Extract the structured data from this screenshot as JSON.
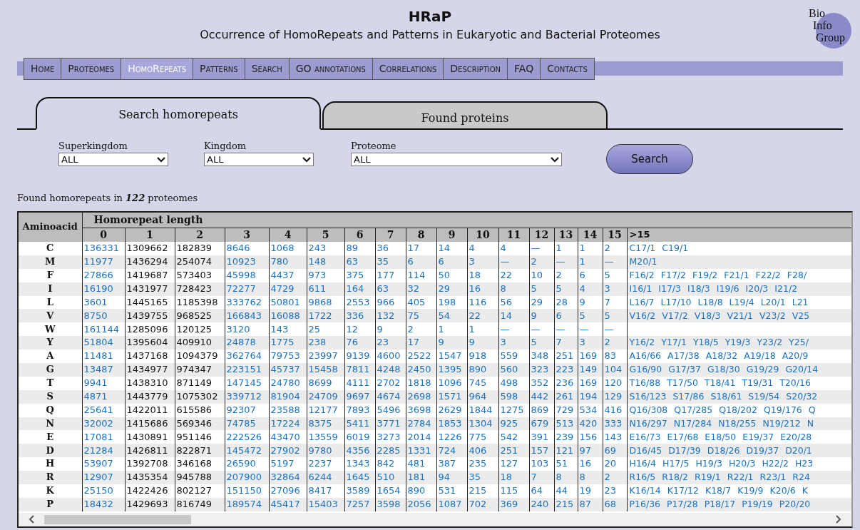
{
  "header": {
    "title": "HRaP",
    "subtitle": "Occurrence of HomoRepeats and Patterns in Eukaryotic and Bacterial Proteomes"
  },
  "logo": {
    "lines": [
      "Bio",
      "Info",
      "Group"
    ]
  },
  "nav": [
    {
      "label": "Home",
      "selected": false
    },
    {
      "label": "Proteomes",
      "selected": false
    },
    {
      "label": "HomoRepeats",
      "selected": true
    },
    {
      "label": "Patterns",
      "selected": false
    },
    {
      "label": "Search",
      "selected": false
    },
    {
      "label": "GO annotations",
      "selected": false
    },
    {
      "label": "Correlations",
      "selected": false
    },
    {
      "label": "Description",
      "selected": false
    },
    {
      "label": "FAQ",
      "selected": false
    },
    {
      "label": "Contacts",
      "selected": false
    }
  ],
  "tabs": [
    {
      "label": "Search homorepeats",
      "selected": true
    },
    {
      "label": "Found proteins",
      "selected": false
    }
  ],
  "filters": [
    {
      "label": "Superkingdom",
      "value": "ALL"
    },
    {
      "label": "Kingdom",
      "value": "ALL"
    },
    {
      "label": "Proteome",
      "value": "ALL"
    }
  ],
  "search_button": "Search",
  "summary": "Found homorepeats in **122** proteomes",
  "table": {
    "row_header": "Aminoacid",
    "group_header": "Homorepeat length",
    "columns": [
      {
        "label": "0",
        "linked": true
      },
      {
        "label": "1",
        "linked": false
      },
      {
        "label": "2",
        "linked": false
      },
      {
        "label": "3",
        "linked": true
      },
      {
        "label": "4",
        "linked": true
      },
      {
        "label": "5",
        "linked": true
      },
      {
        "label": "6",
        "linked": true
      },
      {
        "label": "7",
        "linked": true
      },
      {
        "label": "8",
        "linked": true
      },
      {
        "label": "9",
        "linked": true
      },
      {
        "label": "10",
        "linked": true
      },
      {
        "label": "11",
        "linked": true
      },
      {
        "label": "12",
        "linked": true
      },
      {
        "label": "13",
        "linked": true
      },
      {
        "label": "14",
        "linked": true
      },
      {
        "label": "15",
        "linked": true
      }
    ],
    "longer_header": ">15",
    "rows": [
      {
        "aminoacid": "C",
        "values": [
          "136331",
          "1309662",
          "182839",
          "8646",
          "1068",
          "243",
          "89",
          "36",
          "17",
          "14",
          "4",
          "4",
          "—",
          "1",
          "1",
          "2"
        ],
        "longer": [
          "C17/1",
          "C19/1"
        ]
      },
      {
        "aminoacid": "M",
        "values": [
          "11977",
          "1436294",
          "254074",
          "10923",
          "780",
          "148",
          "63",
          "35",
          "6",
          "6",
          "3",
          "—",
          "2",
          "—",
          "1",
          "—"
        ],
        "longer": [
          "M20/1"
        ]
      },
      {
        "aminoacid": "F",
        "values": [
          "27866",
          "1419687",
          "573403",
          "45998",
          "4437",
          "973",
          "375",
          "177",
          "114",
          "50",
          "18",
          "22",
          "10",
          "2",
          "6",
          "5"
        ],
        "longer": [
          "F16/2",
          "F17/2",
          "F19/2",
          "F21/1",
          "F22/2",
          "F28/"
        ]
      },
      {
        "aminoacid": "I",
        "values": [
          "16190",
          "1431977",
          "728423",
          "72277",
          "4729",
          "611",
          "164",
          "63",
          "32",
          "29",
          "16",
          "8",
          "5",
          "5",
          "4",
          "3"
        ],
        "longer": [
          "I16/1",
          "I17/3",
          "I18/3",
          "I19/6",
          "I20/3",
          "I21/2"
        ]
      },
      {
        "aminoacid": "L",
        "values": [
          "3601",
          "1445165",
          "1185398",
          "333762",
          "50801",
          "9868",
          "2553",
          "966",
          "405",
          "198",
          "116",
          "56",
          "29",
          "28",
          "9",
          "7"
        ],
        "longer": [
          "L16/7",
          "L17/10",
          "L18/8",
          "L19/4",
          "L20/1",
          "L21"
        ]
      },
      {
        "aminoacid": "V",
        "values": [
          "8750",
          "1439755",
          "968525",
          "166843",
          "16088",
          "1722",
          "336",
          "132",
          "75",
          "54",
          "22",
          "14",
          "9",
          "6",
          "5",
          "5"
        ],
        "longer": [
          "V16/2",
          "V17/2",
          "V18/3",
          "V21/1",
          "V23/2",
          "V25"
        ]
      },
      {
        "aminoacid": "W",
        "values": [
          "161144",
          "1285096",
          "120125",
          "3120",
          "143",
          "25",
          "12",
          "9",
          "2",
          "1",
          "1",
          "—",
          "—",
          "—",
          "—",
          "—"
        ]
      },
      {
        "aminoacid": "Y",
        "values": [
          "51804",
          "1395604",
          "409910",
          "24878",
          "1775",
          "238",
          "76",
          "23",
          "17",
          "9",
          "9",
          "3",
          "5",
          "7",
          "3",
          "2"
        ],
        "longer": [
          "Y16/2",
          "Y17/1",
          "Y18/5",
          "Y19/3",
          "Y23/2",
          "Y25/"
        ]
      },
      {
        "aminoacid": "A",
        "values": [
          "11481",
          "1437168",
          "1094379",
          "362764",
          "79753",
          "23997",
          "9139",
          "4600",
          "2522",
          "1547",
          "918",
          "559",
          "348",
          "251",
          "169",
          "83"
        ],
        "longer": [
          "A16/66",
          "A17/38",
          "A18/32",
          "A19/18",
          "A20/9"
        ]
      },
      {
        "aminoacid": "G",
        "values": [
          "13487",
          "1434977",
          "974347",
          "223151",
          "45737",
          "15458",
          "7811",
          "4248",
          "2450",
          "1395",
          "890",
          "560",
          "323",
          "223",
          "149",
          "104"
        ],
        "longer": [
          "G16/90",
          "G17/37",
          "G18/30",
          "G19/29",
          "G20/14"
        ]
      },
      {
        "aminoacid": "T",
        "values": [
          "9941",
          "1438310",
          "871149",
          "147145",
          "24780",
          "8699",
          "4111",
          "2702",
          "1818",
          "1096",
          "745",
          "498",
          "352",
          "236",
          "169",
          "120"
        ],
        "longer": [
          "T16/88",
          "T17/50",
          "T18/41",
          "T19/31",
          "T20/16"
        ]
      },
      {
        "aminoacid": "S",
        "values": [
          "4871",
          "1443779",
          "1075302",
          "339712",
          "81904",
          "24709",
          "9697",
          "4674",
          "2698",
          "1571",
          "964",
          "598",
          "442",
          "261",
          "194",
          "129"
        ],
        "longer": [
          "S16/123",
          "S17/86",
          "S18/61",
          "S19/54",
          "S20/32"
        ]
      },
      {
        "aminoacid": "Q",
        "values": [
          "25641",
          "1422011",
          "615586",
          "92307",
          "23588",
          "12177",
          "7893",
          "5496",
          "3698",
          "2629",
          "1844",
          "1275",
          "869",
          "729",
          "534",
          "416"
        ],
        "longer": [
          "Q16/308",
          "Q17/285",
          "Q18/202",
          "Q19/176",
          "Q"
        ]
      },
      {
        "aminoacid": "N",
        "values": [
          "32002",
          "1415686",
          "569346",
          "74785",
          "17224",
          "8375",
          "5411",
          "3771",
          "2784",
          "1853",
          "1304",
          "925",
          "679",
          "513",
          "420",
          "333"
        ],
        "longer": [
          "N16/297",
          "N17/284",
          "N18/255",
          "N19/212",
          "N"
        ]
      },
      {
        "aminoacid": "E",
        "values": [
          "17081",
          "1430891",
          "951146",
          "222526",
          "43470",
          "13559",
          "6019",
          "3273",
          "2014",
          "1226",
          "775",
          "542",
          "391",
          "239",
          "156",
          "143"
        ],
        "longer": [
          "E16/73",
          "E17/68",
          "E18/50",
          "E19/37",
          "E20/28"
        ]
      },
      {
        "aminoacid": "D",
        "values": [
          "21284",
          "1426811",
          "822871",
          "145472",
          "27902",
          "9780",
          "4356",
          "2285",
          "1331",
          "724",
          "406",
          "251",
          "157",
          "121",
          "97",
          "69"
        ],
        "longer": [
          "D16/45",
          "D17/39",
          "D18/26",
          "D19/37",
          "D20/1"
        ]
      },
      {
        "aminoacid": "H",
        "values": [
          "53907",
          "1392708",
          "346168",
          "26590",
          "5197",
          "2237",
          "1343",
          "842",
          "481",
          "387",
          "235",
          "127",
          "103",
          "51",
          "16",
          "20"
        ],
        "longer": [
          "H16/4",
          "H17/5",
          "H19/3",
          "H20/3",
          "H22/2",
          "H23"
        ]
      },
      {
        "aminoacid": "R",
        "values": [
          "12907",
          "1435354",
          "945788",
          "207900",
          "32864",
          "6244",
          "1645",
          "510",
          "181",
          "94",
          "35",
          "18",
          "7",
          "8",
          "8",
          "2"
        ],
        "longer": [
          "R16/5",
          "R18/2",
          "R19/1",
          "R22/1",
          "R23/1",
          "R24"
        ]
      },
      {
        "aminoacid": "K",
        "values": [
          "25150",
          "1422426",
          "802127",
          "151150",
          "27096",
          "8417",
          "3589",
          "1654",
          "890",
          "531",
          "215",
          "115",
          "64",
          "44",
          "19",
          "23"
        ],
        "longer": [
          "K16/14",
          "K17/12",
          "K18/7",
          "K19/9",
          "K20/6",
          "K"
        ]
      },
      {
        "aminoacid": "P",
        "values": [
          "18432",
          "1429693",
          "816749",
          "189574",
          "45417",
          "15403",
          "7257",
          "3598",
          "2056",
          "1087",
          "702",
          "369",
          "240",
          "215",
          "87",
          "68"
        ],
        "longer": [
          "P16/36",
          "P17/28",
          "P18/17",
          "P19/19",
          "P20/20"
        ]
      }
    ]
  }
}
